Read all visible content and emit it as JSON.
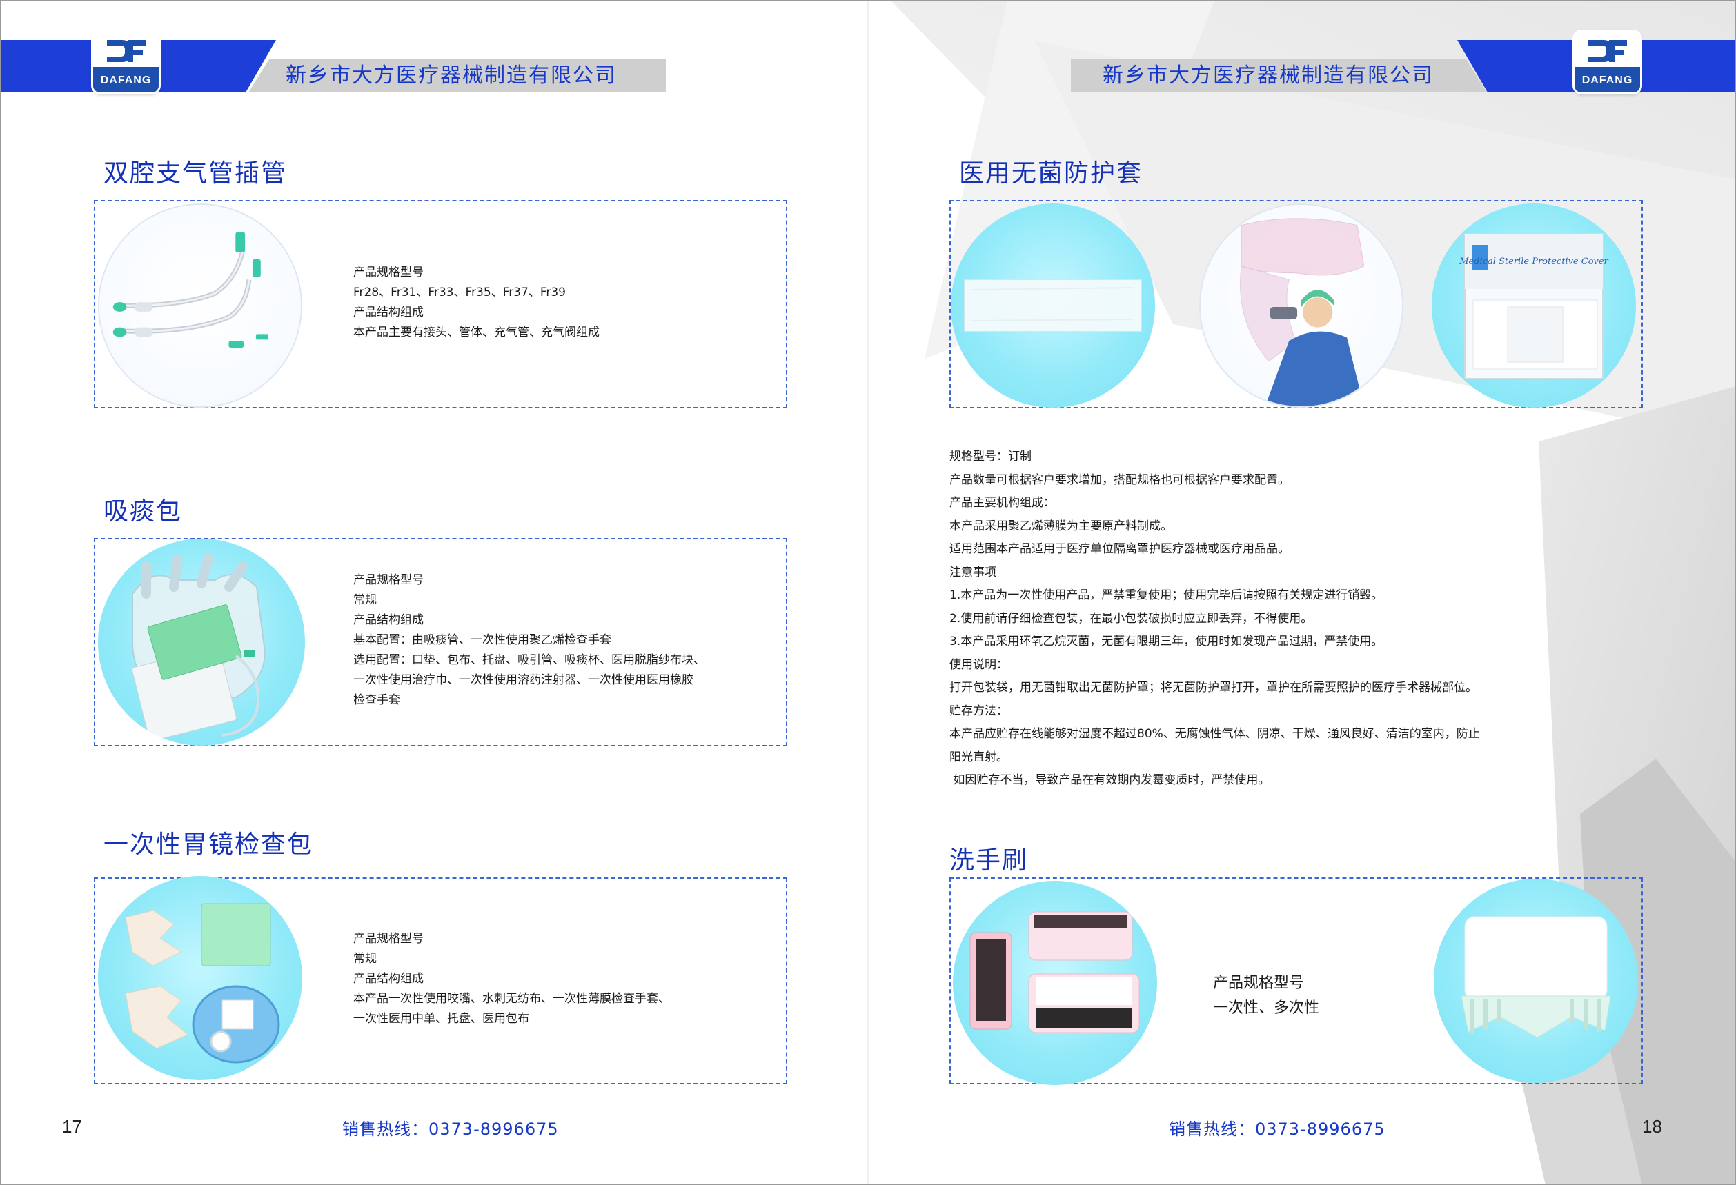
{
  "header": {
    "logo_text": "DAFANG",
    "company_left": "新乡市大方医疗器械制造有限公司",
    "company_right": "新乡市大方医疗器械制造有限公司"
  },
  "left_page": {
    "page_number": "17",
    "hotline": "销售热线：0373-8996675",
    "products": [
      {
        "title": "双腔支气管插管",
        "lines": [
          "产品规格型号",
          "Fr28、Fr31、Fr33、Fr35、Fr37、Fr39",
          "产品结构组成",
          "本产品主要有接头、管体、充气管、充气阀组成"
        ]
      },
      {
        "title": "吸痰包",
        "lines": [
          "产品规格型号",
          "常规",
          "产品结构组成",
          "基本配置：由吸痰管、一次性使用聚乙烯检查手套",
          "选用配置：口垫、包布、托盘、吸引管、吸痰杯、医用脱脂纱布块、",
          "一次性使用治疗巾、一次性使用溶药注射器、一次性使用医用橡胶",
          "检查手套"
        ]
      },
      {
        "title": "一次性胃镜检查包",
        "lines": [
          "产品规格型号",
          "常规",
          "产品结构组成",
          "本产品一次性使用咬嘴、水刺无纺布、一次性薄膜检查手套、",
          "一次性医用中单、托盘、医用包布"
        ]
      }
    ]
  },
  "right_page": {
    "page_number": "18",
    "hotline": "销售热线：0373-8996675",
    "cover": {
      "title": "医用无菌防护套",
      "package_label": "Medical Sterile Protective Cover",
      "description": [
        "规格型号：订制",
        "产品数量可根据客户要求增加，搭配规格也可根据客户要求配置。",
        "产品主要机构组成：",
        "本产品采用聚乙烯薄膜为主要原产料制成。",
        "适用范围本产品适用于医疗单位隔离罩护医疗器械或医疗用品品。",
        "注意事项",
        "1.本产品为一次性使用产品，严禁重复使用；使用完毕后请按照有关规定进行销毁。",
        "2.使用前请仔细检查包装，在最小包装破损时应立即丢弃，不得使用。",
        "3.本产品采用环氧乙烷灭菌，无菌有限期三年，使用时如发现产品过期，严禁使用。",
        "使用说明：",
        "打开包装袋，用无菌钳取出无菌防护罩；将无菌防护罩打开，罩护在所需要照护的医疗手术器械部位。",
        "贮存方法：",
        "本产品应贮存在线能够对湿度不超过80%、无腐蚀性气体、阴凉、干燥、通风良好、清洁的室内，防止",
        "阳光直射。",
        " 如因贮存不当，导致产品在有效期内发霉变质时，严禁使用。"
      ]
    },
    "brush": {
      "title": "洗手刷",
      "lines": [
        "产品规格型号",
        "一次性、多次性"
      ]
    }
  },
  "colors": {
    "brand_blue": "#1d3fd8",
    "title_blue": "#1431b8",
    "frame_dash": "#3b64d6",
    "circle_cyan": "#8fe9f8",
    "header_gray": "#cfcfcf"
  }
}
